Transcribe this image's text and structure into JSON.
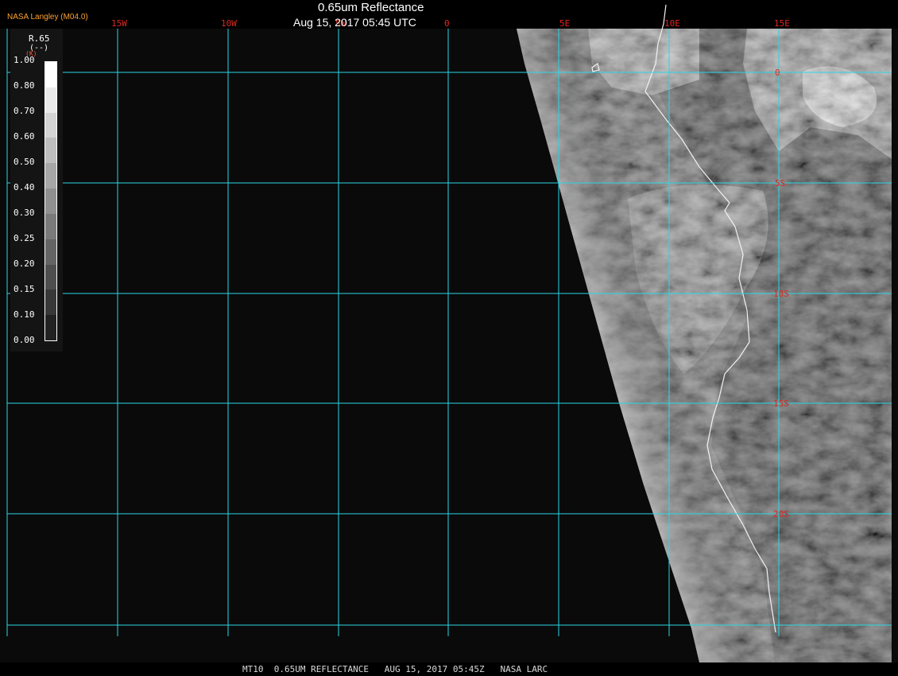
{
  "header": {
    "source": "NASA Langley (M04.0)",
    "product_title": "0.65um Reflectance",
    "timestamp": "Aug 15, 2017 05:45 UTC"
  },
  "colorbar": {
    "variable": "R.65",
    "units": "(--)",
    "units_prefix": "(K)",
    "ticks": [
      "1.00",
      "0.80",
      "0.70",
      "0.60",
      "0.50",
      "0.40",
      "0.30",
      "0.25",
      "0.20",
      "0.15",
      "0.10",
      "0.00"
    ],
    "range": [
      0.0,
      1.0
    ]
  },
  "map": {
    "longitude_labels": [
      "15W",
      "10W",
      "5W",
      "0",
      "5E",
      "10E",
      "15E"
    ],
    "latitude_labels": [
      "0",
      "5S",
      "10S",
      "15S",
      "20S"
    ],
    "colors": {
      "grid": "#29d6e6",
      "grid_labels": "#e0281e",
      "coastline": "#f2f2f2",
      "background": "#0a0a0a"
    }
  },
  "footer": {
    "caption": "MT10  0.65UM REFLECTANCE   AUG 15, 2017 05:45Z   NASA LARC"
  }
}
